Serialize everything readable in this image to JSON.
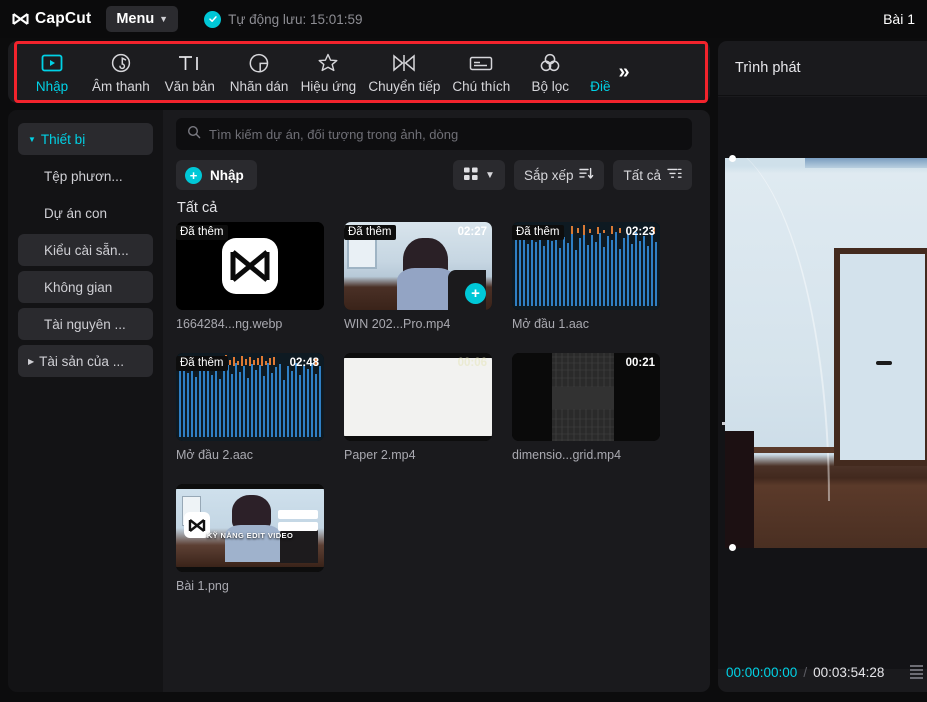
{
  "titlebar": {
    "brand": "CapCut",
    "brand_icon": "capcut-logo-icon",
    "menu_label": "Menu",
    "menu_caret_icon": "chevron-down-icon",
    "autosave_check_icon": "check-circle-icon",
    "autosave_text": "Tự động lưu: 15:01:59",
    "project_name": "Bài 1"
  },
  "toolbar": {
    "tabs": [
      {
        "label": "Nhập",
        "icon": "media-import-icon",
        "active": true
      },
      {
        "label": "Âm thanh",
        "icon": "music-note-icon",
        "active": false
      },
      {
        "label": "Văn bản",
        "icon": "text-ti-icon",
        "active": false
      },
      {
        "label": "Nhãn dán",
        "icon": "sticker-icon",
        "active": false
      },
      {
        "label": "Hiệu ứng",
        "icon": "sparkle-star-icon",
        "active": false
      },
      {
        "label": "Chuyển tiếp",
        "icon": "transition-icon",
        "active": false
      },
      {
        "label": "Chú thích",
        "icon": "caption-icon",
        "active": false
      },
      {
        "label": "Bộ lọc",
        "icon": "filter-circles-icon",
        "active": false
      },
      {
        "label": "Điề",
        "icon": "adjust-icon",
        "active": false,
        "clipped": true
      }
    ],
    "more_label": "»",
    "more_icon": "chevron-double-right-icon",
    "highlight_color": "#f2232c",
    "accent_color": "#00d2e6"
  },
  "sidebar": {
    "items": [
      {
        "label": "Thiết bị",
        "icon": "caret-down-icon",
        "boxed": true,
        "active": true,
        "indent": false
      },
      {
        "label": "Tệp phươn...",
        "icon": "",
        "boxed": false,
        "active": false,
        "indent": true
      },
      {
        "label": "Dự án con",
        "icon": "",
        "boxed": false,
        "active": false,
        "indent": true
      },
      {
        "label": "Kiểu cài sẵn...",
        "icon": "",
        "boxed": true,
        "active": false,
        "indent": true
      },
      {
        "label": "Không gian",
        "icon": "",
        "boxed": true,
        "active": false,
        "indent": true
      },
      {
        "label": "Tài nguyên ...",
        "icon": "",
        "boxed": true,
        "active": false,
        "indent": true
      },
      {
        "label": "Tài sản của ...",
        "icon": "caret-right-icon",
        "boxed": true,
        "active": false,
        "indent": false
      }
    ]
  },
  "media_panel": {
    "search": {
      "icon": "search-icon",
      "placeholder": "Tìm kiếm dự án, đối tượng trong ảnh, dòng",
      "value": ""
    },
    "import_button": {
      "label": "Nhập",
      "icon": "plus-circle-icon"
    },
    "view_mode": {
      "icon": "grid-view-icon",
      "caret": "chevron-down-icon"
    },
    "sort_button": {
      "label": "Sắp xếp",
      "icon": "sort-descending-icon"
    },
    "filter_button": {
      "label": "Tất cả",
      "icon": "filter-funnel-icon"
    },
    "section_title": "Tất cả",
    "added_badge": "Đã thêm",
    "add_fab": "+",
    "items": [
      {
        "name": "1664284...ng.webp",
        "duration": "",
        "added": true,
        "art": "capcut",
        "fab": false
      },
      {
        "name": "WIN 202...Pro.mp4",
        "duration": "02:27",
        "added": true,
        "art": "room",
        "fab": true
      },
      {
        "name": "Mở đầu 1.aac",
        "duration": "02:23",
        "added": true,
        "art": "audio",
        "fab": false
      },
      {
        "name": "Mở đầu 2.aac",
        "duration": "02:48",
        "added": true,
        "art": "audio",
        "fab": false
      },
      {
        "name": "Paper 2.mp4",
        "duration": "00:06",
        "added": false,
        "art": "paper",
        "fab": false
      },
      {
        "name": "dimensio...grid.mp4",
        "duration": "00:21",
        "added": false,
        "art": "grid3d",
        "fab": false
      },
      {
        "name": "Bài 1.png",
        "duration": "",
        "added": false,
        "art": "lesson",
        "fab": false
      }
    ],
    "lesson_caption": "KỸ NĂNG EDIT VIDEO"
  },
  "player": {
    "title": "Trình phát",
    "current_time": "00:00:00:00",
    "separator": "/",
    "total_time": "00:03:54:28",
    "current_time_color": "#00d2e6"
  }
}
